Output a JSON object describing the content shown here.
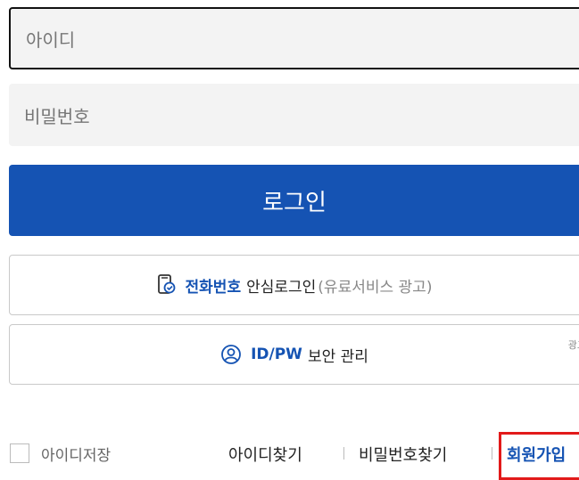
{
  "login": {
    "id_placeholder": "아이디",
    "pw_placeholder": "비밀번호",
    "login_label": "로그인"
  },
  "phone_login": {
    "highlight": "전화번호",
    "main": "안심로그인",
    "note": "(유료서비스 광고)"
  },
  "idpw": {
    "highlight": "ID/PW",
    "main": "보안 관리",
    "ad_tag": "광고"
  },
  "bottom": {
    "remember_label": "아이디저장",
    "find_id": "아이디찾기",
    "find_pw": "비밀번호찾기",
    "signup": "회원가입"
  },
  "colors": {
    "accent": "#1553b3",
    "highlight_box": "#e21a1a"
  },
  "icons": {
    "phone": "phone-shield-icon",
    "user": "user-circle-icon"
  }
}
